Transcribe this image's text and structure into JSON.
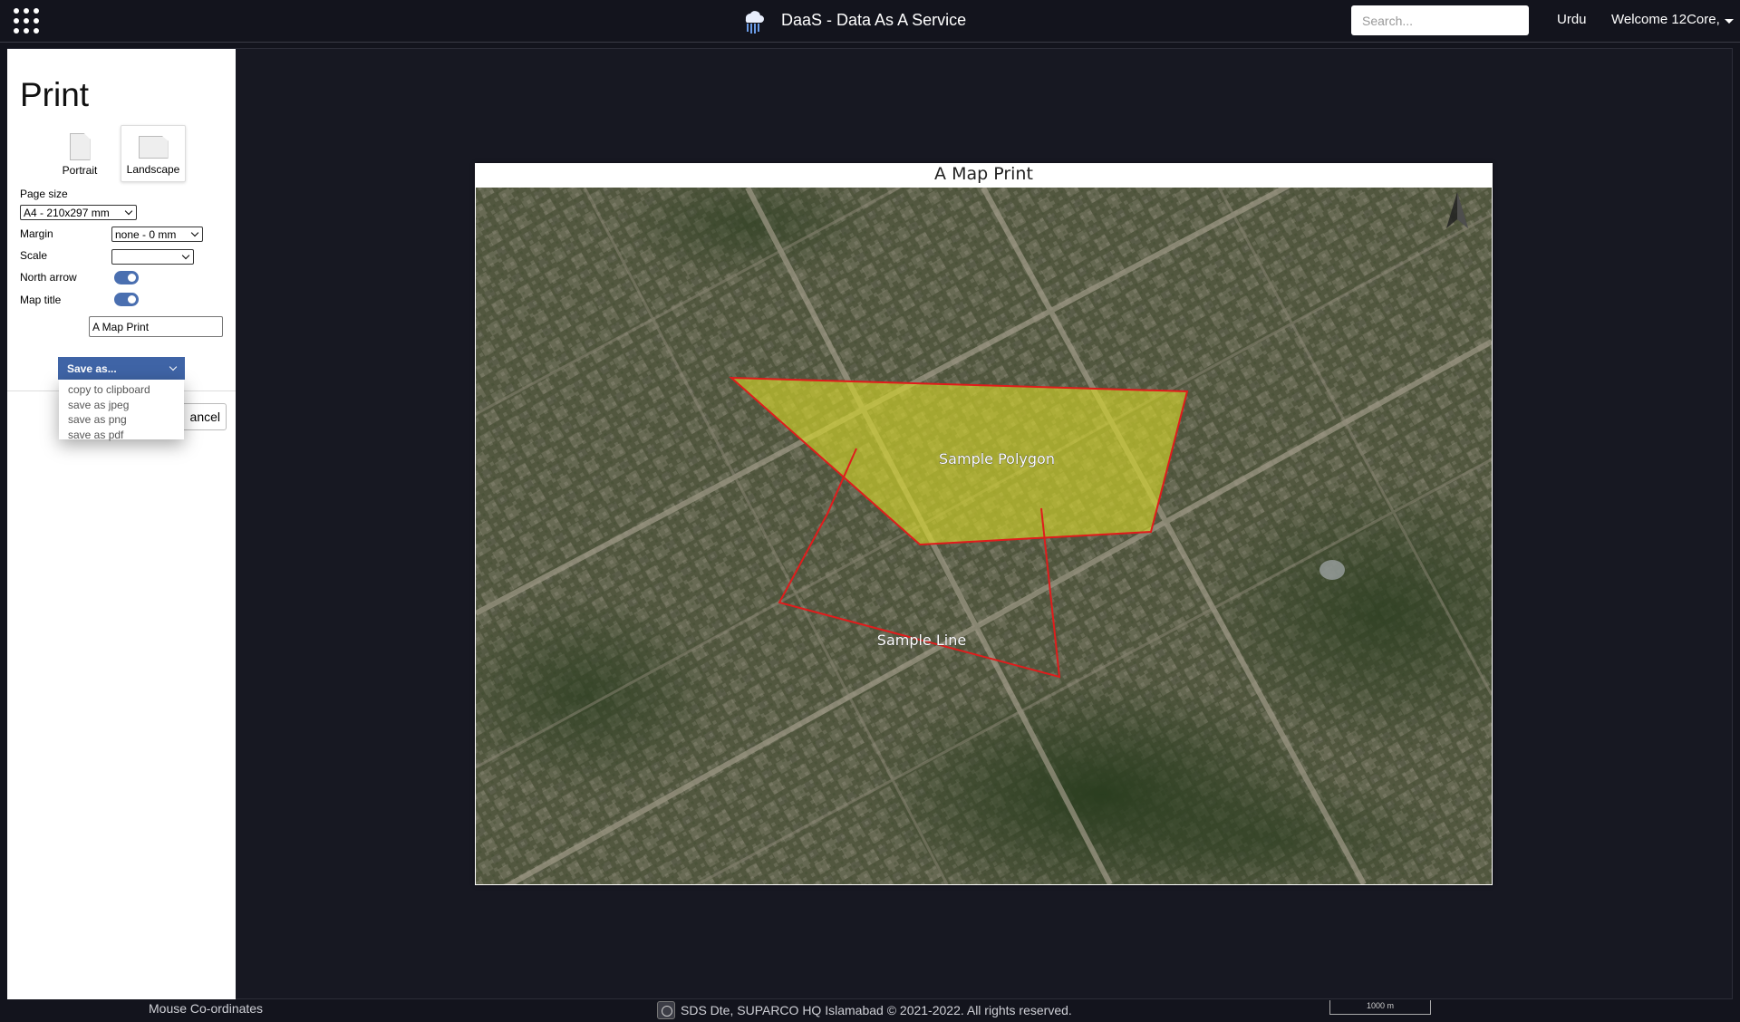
{
  "header": {
    "app_title": "DaaS - Data As A Service",
    "search_placeholder": "Search...",
    "language": "Urdu",
    "welcome": "Welcome 12Core,"
  },
  "print_panel": {
    "title": "Print",
    "orientations": [
      "Portrait",
      "Landscape"
    ],
    "selected_orientation": "Landscape",
    "page_size_label": "Page size",
    "page_size_value": "A4 - 210x297 mm",
    "margin_label": "Margin",
    "margin_value": "none - 0 mm",
    "scale_label": "Scale",
    "scale_value": "",
    "north_arrow_label": "North arrow",
    "north_arrow_on": true,
    "map_title_label": "Map title",
    "map_title_on": true,
    "map_title_value": "A Map Print",
    "save_as_label": "Save as...",
    "save_options": [
      "copy to clipboard",
      "save as jpeg",
      "save as png",
      "save as pdf"
    ],
    "cancel_label": "ancel"
  },
  "map_preview": {
    "title": "A Map Print",
    "features": [
      {
        "name": "Sample Polygon",
        "type": "polygon",
        "fill": "#dcdc28",
        "stroke": "#e01c1c"
      },
      {
        "name": "Sample Line",
        "type": "line",
        "stroke": "#e01c1c"
      }
    ],
    "basemap": "satellite imagery"
  },
  "footer": {
    "coords_label": "Mouse Co-ordinates",
    "copyright": "SDS Dte, SUPARCO HQ Islamabad © 2021-2022. All rights reserved.",
    "scale_bar": "1000 m"
  },
  "colors": {
    "background": "#13141d",
    "panel": "#ffffff",
    "accent": "#3f64a6",
    "toggle": "#4a6fb0",
    "feature_stroke": "#e01c1c",
    "feature_fill": "#dcdc28"
  }
}
